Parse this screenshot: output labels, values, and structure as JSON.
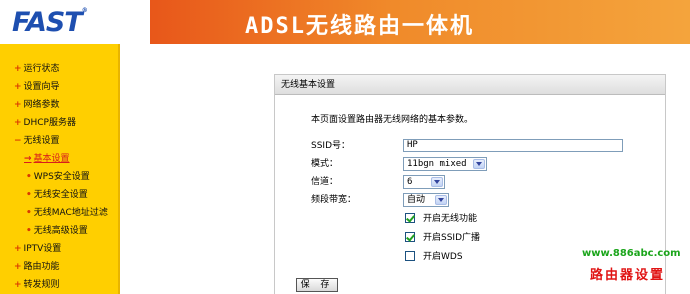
{
  "header": {
    "logo": "FAST",
    "logo_mark": "®",
    "banner_title": "ADSL无线路由一体机",
    "colors": {
      "logo": "#1e4fb0",
      "banner_start": "#e8571a",
      "banner_end": "#f4a43c"
    }
  },
  "sidebar": {
    "background": "#ffcf00",
    "items": [
      {
        "label": "运行状态",
        "level": 1,
        "active": false
      },
      {
        "label": "设置向导",
        "level": 1,
        "active": false
      },
      {
        "label": "网络参数",
        "level": 1,
        "active": false
      },
      {
        "label": "DHCP服务器",
        "level": 1,
        "active": false
      },
      {
        "label": "无线设置",
        "level": 1,
        "active": false,
        "bullet": "−"
      },
      {
        "label": "基本设置",
        "level": 2,
        "active": true
      },
      {
        "label": "WPS安全设置",
        "level": 2,
        "active": false
      },
      {
        "label": "无线安全设置",
        "level": 2,
        "active": false
      },
      {
        "label": "无线MAC地址过滤",
        "level": 2,
        "active": false
      },
      {
        "label": "无线高级设置",
        "level": 2,
        "active": false
      },
      {
        "label": "IPTV设置",
        "level": 1,
        "active": false
      },
      {
        "label": "路由功能",
        "level": 1,
        "active": false
      },
      {
        "label": "转发规则",
        "level": 1,
        "active": false
      }
    ]
  },
  "panel": {
    "title": "无线基本设置",
    "description": "本页面设置路由器无线网络的基本参数。",
    "ssid": {
      "label": "SSID号：",
      "value": "HP"
    },
    "mode": {
      "label": "模式：",
      "value": "11bgn mixed"
    },
    "channel": {
      "label": "信道：",
      "value": "6"
    },
    "bandwidth": {
      "label": "频段带宽：",
      "value": "自动"
    },
    "checkboxes": [
      {
        "label": "开启无线功能",
        "checked": true
      },
      {
        "label": "开启SSID广播",
        "checked": true
      },
      {
        "label": "开启WDS",
        "checked": false
      }
    ],
    "save_label": "保 存"
  },
  "watermark": {
    "url": "www.886abc.com",
    "text": "路由器设置"
  }
}
